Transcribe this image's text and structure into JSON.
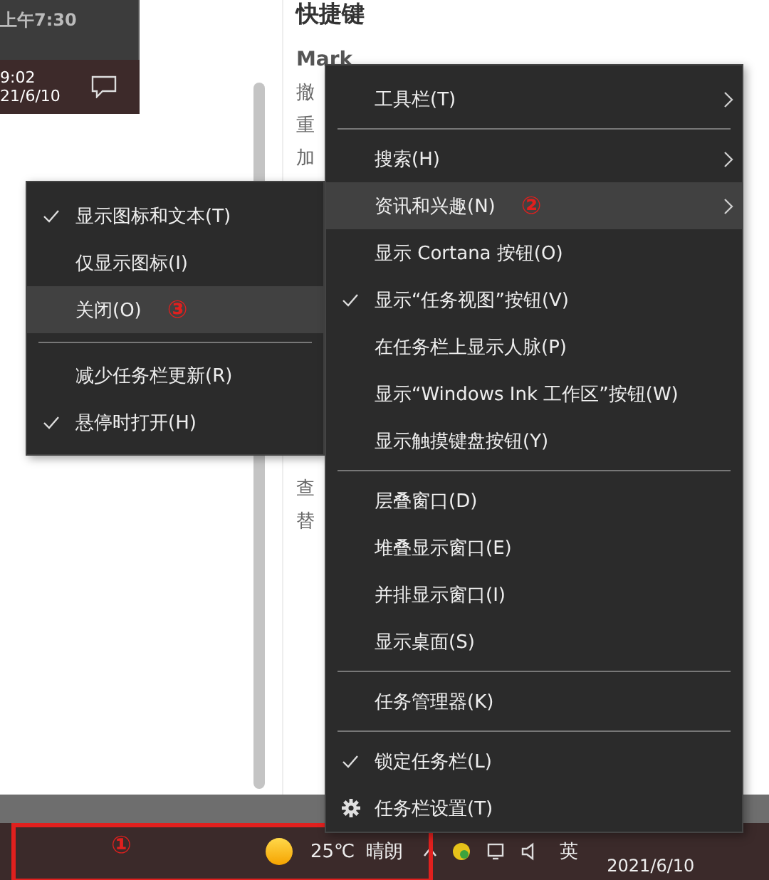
{
  "thumbnail": {
    "time": "上午7:30",
    "clock_time": "9:02",
    "clock_date": "21/6/10"
  },
  "document": {
    "heading": "快捷键",
    "column_1": "Mark",
    "rows_top": [
      "撤",
      "重",
      "加"
    ],
    "rows_bottom": [
      "查",
      "替"
    ]
  },
  "taskbar": {
    "annotation": "①",
    "temperature": "25℃",
    "weather": "晴朗",
    "input_method": "英",
    "date": "2021/6/10"
  },
  "context_menu": {
    "items": [
      {
        "kind": "item",
        "label": "工具栏(T)",
        "checked": false,
        "selected": false,
        "submenu": true
      },
      {
        "kind": "separator"
      },
      {
        "kind": "item",
        "label": "搜索(H)",
        "checked": false,
        "selected": false,
        "submenu": true
      },
      {
        "kind": "item",
        "label": "资讯和兴趣(N)",
        "checked": false,
        "selected": true,
        "submenu": true,
        "annotation": "②"
      },
      {
        "kind": "item",
        "label": "显示 Cortana 按钮(O)",
        "checked": false,
        "selected": false,
        "submenu": false
      },
      {
        "kind": "item",
        "label": "显示“任务视图”按钮(V)",
        "checked": true,
        "selected": false,
        "submenu": false
      },
      {
        "kind": "item",
        "label": "在任务栏上显示人脉(P)",
        "checked": false,
        "selected": false,
        "submenu": false
      },
      {
        "kind": "item",
        "label": "显示“Windows Ink 工作区”按钮(W)",
        "checked": false,
        "selected": false,
        "submenu": false
      },
      {
        "kind": "item",
        "label": "显示触摸键盘按钮(Y)",
        "checked": false,
        "selected": false,
        "submenu": false
      },
      {
        "kind": "separator"
      },
      {
        "kind": "item",
        "label": "层叠窗口(D)",
        "checked": false,
        "selected": false,
        "submenu": false
      },
      {
        "kind": "item",
        "label": "堆叠显示窗口(E)",
        "checked": false,
        "selected": false,
        "submenu": false
      },
      {
        "kind": "item",
        "label": "并排显示窗口(I)",
        "checked": false,
        "selected": false,
        "submenu": false
      },
      {
        "kind": "item",
        "label": "显示桌面(S)",
        "checked": false,
        "selected": false,
        "submenu": false
      },
      {
        "kind": "separator"
      },
      {
        "kind": "item",
        "label": "任务管理器(K)",
        "checked": false,
        "selected": false,
        "submenu": false
      },
      {
        "kind": "separator"
      },
      {
        "kind": "item",
        "label": "锁定任务栏(L)",
        "checked": true,
        "selected": false,
        "submenu": false
      },
      {
        "kind": "settings",
        "label": "任务栏设置(T)",
        "checked": false,
        "selected": false,
        "submenu": false
      }
    ]
  },
  "submenu": {
    "items": [
      {
        "kind": "item",
        "label": "显示图标和文本(T)",
        "checked": true,
        "selected": false
      },
      {
        "kind": "item",
        "label": "仅显示图标(I)",
        "checked": false,
        "selected": false
      },
      {
        "kind": "item",
        "label": "关闭(O)",
        "checked": false,
        "selected": true,
        "annotation": "③"
      },
      {
        "kind": "separator"
      },
      {
        "kind": "item",
        "label": "减少任务栏更新(R)",
        "checked": false,
        "selected": false
      },
      {
        "kind": "item",
        "label": "悬停时打开(H)",
        "checked": true,
        "selected": false
      }
    ]
  }
}
